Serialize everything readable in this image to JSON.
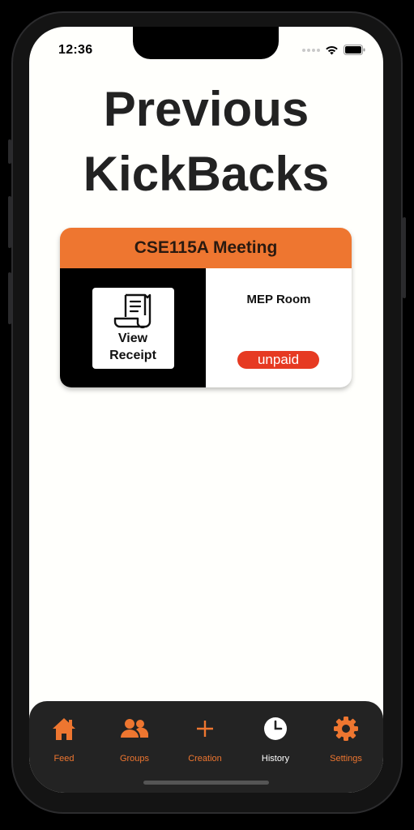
{
  "status_bar": {
    "time": "12:36"
  },
  "page": {
    "title_line1": "Previous",
    "title_line2": "KickBacks"
  },
  "kickbacks": [
    {
      "title": "CSE115A Meeting",
      "receipt_button_label_line1": "View",
      "receipt_button_label_line2": "Receipt",
      "location": "MEP Room",
      "status": "unpaid"
    }
  ],
  "tab_bar": {
    "tabs": [
      {
        "label": "Feed",
        "icon": "home-icon",
        "active": false
      },
      {
        "label": "Groups",
        "icon": "groups-icon",
        "active": false
      },
      {
        "label": "Creation",
        "icon": "plus-icon",
        "active": false
      },
      {
        "label": "History",
        "icon": "clock-icon",
        "active": true
      },
      {
        "label": "Settings",
        "icon": "gear-icon",
        "active": false
      }
    ]
  },
  "colors": {
    "accent": "#ee7630",
    "unpaid": "#e63a22",
    "tab_bar_bg": "#232323",
    "screen_bg": "#fffffc"
  }
}
